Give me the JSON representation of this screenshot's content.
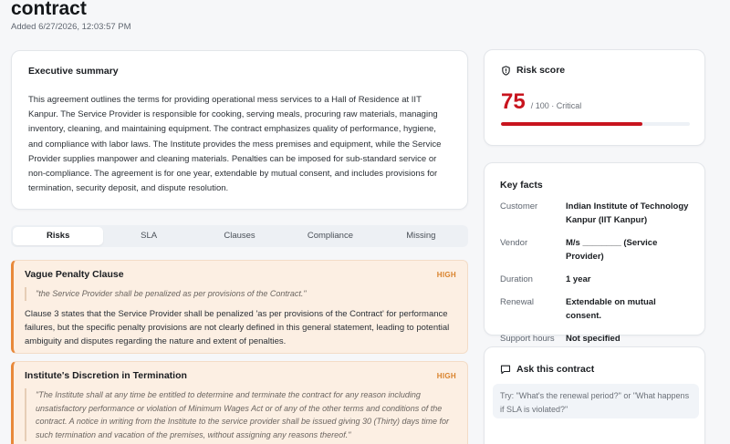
{
  "header": {
    "title": "contract",
    "added": "Added 6/27/2026, 12:03:57 PM"
  },
  "summary": {
    "heading": "Executive summary",
    "text": "This agreement outlines the terms for providing operational mess services to a Hall of Residence at IIT Kanpur. The Service Provider is responsible for cooking, serving meals, procuring raw materials, managing inventory, cleaning, and maintaining equipment. The contract emphasizes quality of performance, hygiene, and compliance with labor laws. The Institute provides the mess premises and equipment, while the Service Provider supplies manpower and cleaning materials. Penalties can be imposed for sub-standard service or non-compliance. The agreement is for one year, extendable by mutual consent, and includes provisions for termination, security deposit, and dispute resolution."
  },
  "tabs": [
    {
      "label": "Risks",
      "active": true
    },
    {
      "label": "SLA",
      "active": false
    },
    {
      "label": "Clauses",
      "active": false
    },
    {
      "label": "Compliance",
      "active": false
    },
    {
      "label": "Missing",
      "active": false
    }
  ],
  "risks": [
    {
      "title": "Vague Penalty Clause",
      "severity": "HIGH",
      "quote": "\"the Service Provider shall be penalized as per provisions of the Contract.\"",
      "body": "Clause 3 states that the Service Provider shall be penalized 'as per provisions of the Contract' for performance failures, but the specific penalty provisions are not clearly defined in this general statement, leading to potential ambiguity and disputes regarding the nature and extent of penalties."
    },
    {
      "title": "Institute's Discretion in Termination",
      "severity": "HIGH",
      "quote": "\"The Institute shall at any time be entitled to determine and terminate the contract for any reason including unsatisfactory performance or violation of Minimum Wages Act or of any of the other terms and conditions of the contract. A notice in writing from the Institute to the service provider shall be issued giving 30 (Thirty) days time for such termination and vacation of the premises, without assigning any reasons thereof.\"",
      "body": ""
    }
  ],
  "risk_score": {
    "heading": "Risk score",
    "value": "75",
    "suffix": "/ 100 · Critical",
    "fraction": 0.75,
    "color": "#c8141e"
  },
  "key_facts": {
    "heading": "Key facts",
    "rows": [
      {
        "label": "Customer",
        "value": "Indian Institute of Technology Kanpur (IIT Kanpur)"
      },
      {
        "label": "Vendor",
        "value": "M/s ________ (Service Provider)"
      },
      {
        "label": "Duration",
        "value": "1 year"
      },
      {
        "label": "Renewal",
        "value": "Extendable on mutual consent."
      },
      {
        "label": "Support hours",
        "value": "Not specified"
      }
    ]
  },
  "ask": {
    "heading": "Ask this contract",
    "placeholder": "Try: \"What's the renewal period?\" or \"What happens if SLA is violated?\""
  },
  "icons": {
    "risk_score": "shield-icon",
    "ask": "chat-bubble-icon"
  }
}
